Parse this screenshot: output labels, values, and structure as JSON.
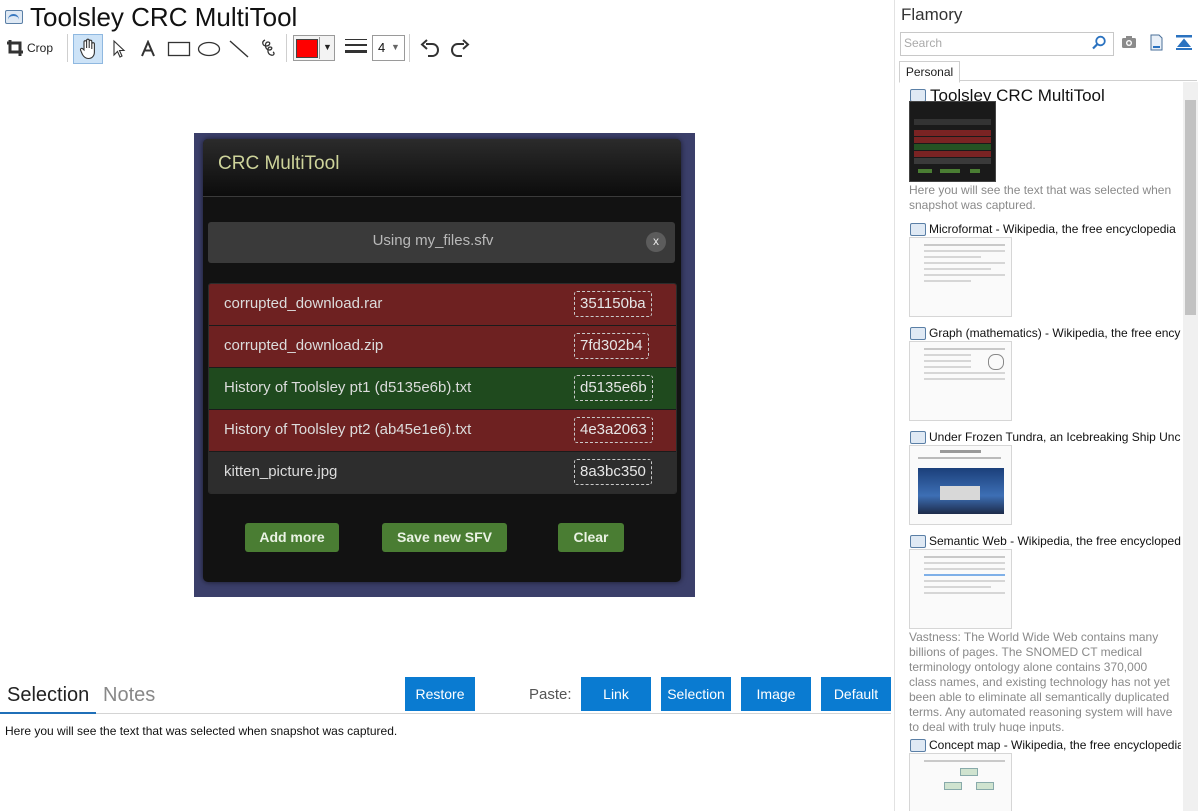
{
  "window": {
    "title": "Toolsley CRC MultiTool"
  },
  "toolbar": {
    "crop_label": "Crop",
    "stroke_width": "4",
    "pen_color": "#ff0000",
    "tools": [
      "pan-tool",
      "select-tool",
      "text-tool",
      "rectangle-tool",
      "ellipse-tool",
      "line-tool",
      "freehand-tool"
    ]
  },
  "snapshot": {
    "modal_title": "CRC MultiTool",
    "using_text": "Using my_files.sfv",
    "close_glyph": "x",
    "files": [
      {
        "name": "corrupted_download.rar",
        "crc": "351150ba",
        "status": "mismatch",
        "color": "#6e2121"
      },
      {
        "name": "corrupted_download.zip",
        "crc": "7fd302b4",
        "status": "mismatch",
        "color": "#6e2121"
      },
      {
        "name": "History of Toolsley pt1 (d5135e6b).txt",
        "crc": "d5135e6b",
        "status": "match",
        "color": "#1f4a1e"
      },
      {
        "name": "History of Toolsley pt2 (ab45e1e6).txt",
        "crc": "4e3a2063",
        "status": "mismatch",
        "color": "#6e2121"
      },
      {
        "name": "kitten_picture.jpg",
        "crc": "8a3bc350",
        "status": "unchecked",
        "color": "#2d2d2d"
      }
    ],
    "buttons": {
      "add_more": "Add more",
      "save_sfv": "Save new SFV",
      "clear": "Clear"
    }
  },
  "bottom": {
    "tabs": {
      "selection": "Selection",
      "notes": "Notes"
    },
    "restore": "Restore",
    "paste_label": "Paste:",
    "paste_buttons": {
      "link": "Link",
      "selection": "Selection",
      "image": "Image",
      "default": "Default"
    },
    "selection_text": "Here you will see the text that was selected when snapshot was captured."
  },
  "sidebar": {
    "app_name": "Flamory",
    "search_placeholder": "Search",
    "tab": "Personal",
    "entries": [
      {
        "title": "Toolsley CRC MultiTool",
        "desc": "Here you will see the text that was selected when snapshot was captured."
      },
      {
        "title": "Microformat - Wikipedia, the free encyclopedia"
      },
      {
        "title": "Graph (mathematics) - Wikipedia, the free ency"
      },
      {
        "title": "Under Frozen Tundra, an Icebreaking Ship Unco"
      },
      {
        "title": "Semantic Web - Wikipedia, the free encycloped",
        "desc": "Vastness: The World Wide Web contains many billions of pages. The SNOMED CT medical terminology ontology alone contains 370,000 class names, and existing technology has not yet been able to eliminate all semantically duplicated terms. Any automated reasoning system will have to deal with truly huge inputs."
      },
      {
        "title": "Concept map - Wikipedia, the free encyclopedia"
      }
    ]
  }
}
